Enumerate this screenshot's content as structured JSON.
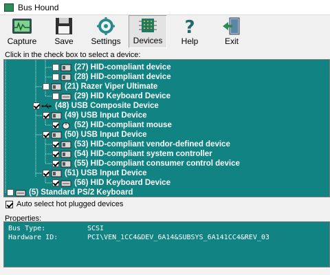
{
  "window": {
    "title": "Bus Hound"
  },
  "toolbar": {
    "buttons": [
      {
        "label": "Capture",
        "icon": "oscilloscope-icon"
      },
      {
        "label": "Save",
        "icon": "floppy-disk-icon"
      },
      {
        "label": "Settings",
        "icon": "gear-icon"
      },
      {
        "label": "Devices",
        "icon": "chip-icon",
        "active": true
      },
      {
        "label": "Help",
        "icon": "question-mark-icon"
      },
      {
        "label": "Exit",
        "icon": "exit-door-icon"
      }
    ]
  },
  "tree": {
    "hint": "Click in the check box to select a device:",
    "items": [
      {
        "label": "(27) HID-compliant device",
        "checked": false,
        "icon": "hid-device-icon"
      },
      {
        "label": "(28) HID-compliant device",
        "checked": false,
        "icon": "hid-device-icon"
      },
      {
        "label": "(21) Razer Viper Ultimate",
        "checked": false,
        "icon": "hid-device-icon"
      },
      {
        "label": "(29) HID Keyboard Device",
        "checked": false,
        "icon": "keyboard-icon"
      },
      {
        "label": "(48) USB Composite Device",
        "checked": true,
        "icon": "usb-icon"
      },
      {
        "label": "(49) USB Input Device",
        "checked": true,
        "icon": "hid-device-icon"
      },
      {
        "label": "(52) HID-compliant mouse",
        "checked": true,
        "icon": "mouse-icon"
      },
      {
        "label": "(50) USB Input Device",
        "checked": true,
        "icon": "hid-device-icon"
      },
      {
        "label": "(53) HID-compliant vendor-defined device",
        "checked": true,
        "icon": "hid-device-icon"
      },
      {
        "label": "(54) HID-compliant system controller",
        "checked": true,
        "icon": "hid-device-icon"
      },
      {
        "label": "(55) HID-compliant consumer control device",
        "checked": true,
        "icon": "hid-device-icon"
      },
      {
        "label": "(51) USB Input Device",
        "checked": true,
        "icon": "hid-device-icon"
      },
      {
        "label": "(56) HID Keyboard Device",
        "checked": true,
        "icon": "keyboard-icon"
      },
      {
        "label": "(5) Standard PS/2 Keyboard",
        "checked": false,
        "icon": "keyboard-icon"
      }
    ]
  },
  "options": {
    "auto_select": "Auto select hot plugged devices",
    "auto_select_checked": true
  },
  "properties": {
    "label": "Properties:",
    "rows": [
      {
        "key": "Bus Type:",
        "value": "SCSI"
      },
      {
        "key": "Hardware ID:",
        "value": "PCI\\VEN_1CC4&DEV_6A14&SUBSYS_6A141CC4&REV_03"
      }
    ]
  },
  "colors": {
    "tree_background": "#118383",
    "text": "#ffffff"
  }
}
